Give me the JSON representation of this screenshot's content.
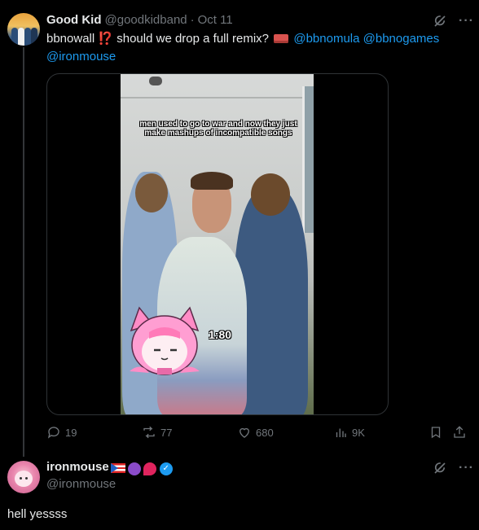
{
  "tweet": {
    "author_name": "Good Kid",
    "author_handle": "@goodkidband",
    "separator": "·",
    "date": "Oct 11",
    "text_part1": "bbnowall",
    "text_emoji": "⁉️",
    "text_part2": " should we drop a full remix?",
    "mentions": [
      "@bbnomula",
      "@bbnogames",
      "@ironmouse"
    ],
    "media": {
      "caption": "men used to go to war and now they just make mashups of incompatible songs",
      "timer": "1:80"
    },
    "stats": {
      "replies": "19",
      "reposts": "77",
      "likes": "680",
      "views": "9K"
    }
  },
  "reply": {
    "author_name": "ironmouse",
    "author_handle": "@ironmouse",
    "text": "hell yessss"
  },
  "icons": {
    "grok": "grok-icon",
    "more": "more-icon",
    "reply": "reply-icon",
    "repost": "repost-icon",
    "like": "like-icon",
    "views": "views-icon",
    "bookmark": "bookmark-icon",
    "share": "share-icon"
  },
  "colors": {
    "background": "#000000",
    "text": "#e7e9ea",
    "muted": "#71767b",
    "link": "#1d9bf0",
    "divider": "#2f3336"
  }
}
